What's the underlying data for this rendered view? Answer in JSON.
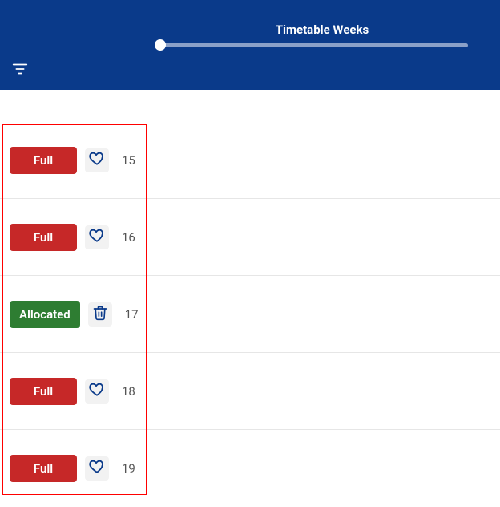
{
  "header": {
    "title": "Timetable Weeks"
  },
  "rows": [
    {
      "status_label": "Full",
      "status_kind": "full",
      "action_icon": "heart",
      "number": "15"
    },
    {
      "status_label": "Full",
      "status_kind": "full",
      "action_icon": "heart",
      "number": "16"
    },
    {
      "status_label": "Allocated",
      "status_kind": "allocated",
      "action_icon": "trash",
      "number": "17"
    },
    {
      "status_label": "Full",
      "status_kind": "full",
      "action_icon": "heart",
      "number": "18"
    },
    {
      "status_label": "Full",
      "status_kind": "full",
      "action_icon": "heart",
      "number": "19"
    }
  ],
  "colors": {
    "header_bg": "#0a3a8a",
    "full_bg": "#c62828",
    "allocated_bg": "#2e7d32",
    "icon_color": "#0a3a8a"
  }
}
